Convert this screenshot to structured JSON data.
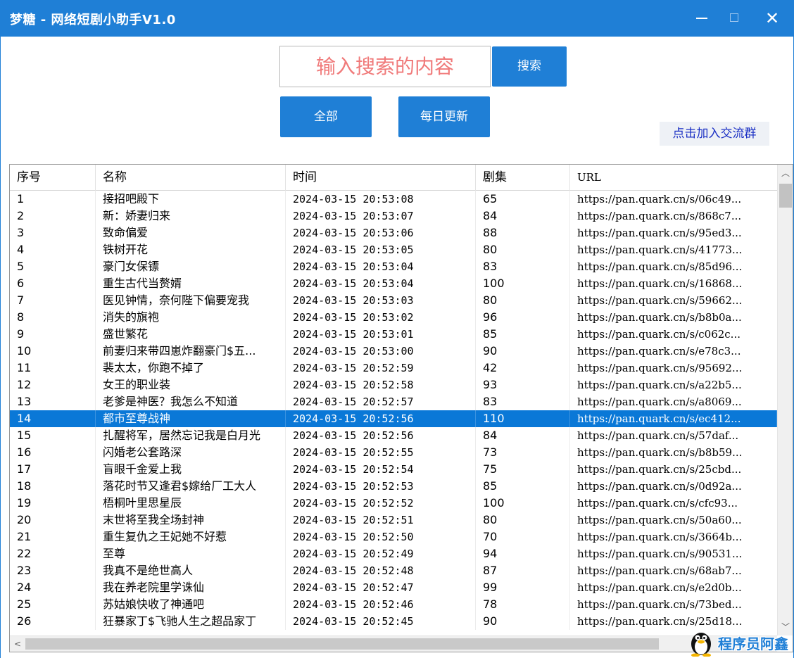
{
  "window": {
    "title": "梦糖 - 网络短剧小助手V1.0",
    "min_glyph": "",
    "max_glyph": "",
    "close_glyph": "✕",
    "accent": "#1f7fd6"
  },
  "search": {
    "placeholder": "输入搜索的内容",
    "button_label": "搜索"
  },
  "filters": {
    "all_label": "全部",
    "daily_label": "每日更新"
  },
  "join_link": "点击加入交流群",
  "table": {
    "columns": [
      "序号",
      "名称",
      "时间",
      "剧集",
      "URL"
    ],
    "selected_index": 13,
    "rows": [
      [
        "1",
        "接招吧殿下",
        "2024-03-15 20:53:08",
        "65",
        "https://pan.quark.cn/s/06c49..."
      ],
      [
        "2",
        "新：娇妻归来",
        "2024-03-15 20:53:07",
        "84",
        "https://pan.quark.cn/s/868c7..."
      ],
      [
        "3",
        "致命偏爱",
        "2024-03-15 20:53:06",
        "88",
        "https://pan.quark.cn/s/95ed3..."
      ],
      [
        "4",
        "铁树开花",
        "2024-03-15 20:53:05",
        "80",
        "https://pan.quark.cn/s/41773..."
      ],
      [
        "5",
        "豪门女保镖",
        "2024-03-15 20:53:04",
        "83",
        "https://pan.quark.cn/s/85d96..."
      ],
      [
        "6",
        "重生古代当赘婿",
        "2024-03-15 20:53:04",
        "100",
        "https://pan.quark.cn/s/16868..."
      ],
      [
        "7",
        "医见钟情，奈何陛下偏要宠我",
        "2024-03-15 20:53:03",
        "80",
        "https://pan.quark.cn/s/59662..."
      ],
      [
        "8",
        "消失的旗袍",
        "2024-03-15 20:53:02",
        "96",
        "https://pan.quark.cn/s/b8b0a..."
      ],
      [
        "9",
        "盛世繁花",
        "2024-03-15 20:53:01",
        "85",
        "https://pan.quark.cn/s/c062c..."
      ],
      [
        "10",
        "前妻归来带四崽炸翻豪门$五...",
        "2024-03-15 20:53:00",
        "90",
        "https://pan.quark.cn/s/e78c3..."
      ],
      [
        "11",
        "裴太太，你跑不掉了",
        "2024-03-15 20:52:59",
        "42",
        "https://pan.quark.cn/s/95692..."
      ],
      [
        "12",
        "女王的职业装",
        "2024-03-15 20:52:58",
        "93",
        "https://pan.quark.cn/s/a22b5..."
      ],
      [
        "13",
        "老爹是神医？我怎么不知道",
        "2024-03-15 20:52:57",
        "83",
        "https://pan.quark.cn/s/a8069..."
      ],
      [
        "14",
        "都市至尊战神",
        "2024-03-15 20:52:56",
        "110",
        "https://pan.quark.cn/s/ec412..."
      ],
      [
        "15",
        "扎醒将军，居然忘记我是白月光",
        "2024-03-15 20:52:56",
        "84",
        "https://pan.quark.cn/s/57daf..."
      ],
      [
        "16",
        "闪婚老公套路深",
        "2024-03-15 20:52:55",
        "73",
        "https://pan.quark.cn/s/b8b59..."
      ],
      [
        "17",
        "盲眼千金爱上我",
        "2024-03-15 20:52:54",
        "75",
        "https://pan.quark.cn/s/25cbd..."
      ],
      [
        "18",
        "落花时节又逢君$嫁给厂工大人",
        "2024-03-15 20:52:53",
        "85",
        "https://pan.quark.cn/s/0d92a..."
      ],
      [
        "19",
        "梧桐叶里思星辰",
        "2024-03-15 20:52:52",
        "100",
        "https://pan.quark.cn/s/cfc93..."
      ],
      [
        "20",
        "末世将至我全场封神",
        "2024-03-15 20:52:51",
        "80",
        "https://pan.quark.cn/s/50a60..."
      ],
      [
        "21",
        "重生复仇之王妃她不好惹",
        "2024-03-15 20:52:50",
        "70",
        "https://pan.quark.cn/s/3664b..."
      ],
      [
        "22",
        "至尊",
        "2024-03-15 20:52:49",
        "94",
        "https://pan.quark.cn/s/90531..."
      ],
      [
        "23",
        "我真不是绝世高人",
        "2024-03-15 20:52:48",
        "87",
        "https://pan.quark.cn/s/68ab7..."
      ],
      [
        "24",
        "我在养老院里学诛仙",
        "2024-03-15 20:52:47",
        "99",
        "https://pan.quark.cn/s/e2d0b..."
      ],
      [
        "25",
        "苏姑娘快收了神通吧",
        "2024-03-15 20:52:46",
        "78",
        "https://pan.quark.cn/s/73bed..."
      ],
      [
        "26",
        "狂暴家丁$飞驰人生之超品家丁",
        "2024-03-15 20:52:45",
        "90",
        "https://pan.quark.cn/s/25d18..."
      ]
    ]
  },
  "scrollbars": {
    "up_glyph": "︿",
    "down_glyph": "﹀",
    "left_glyph": "<"
  },
  "watermark": {
    "text": "程序员阿鑫",
    "icon": "penguin-icon"
  }
}
